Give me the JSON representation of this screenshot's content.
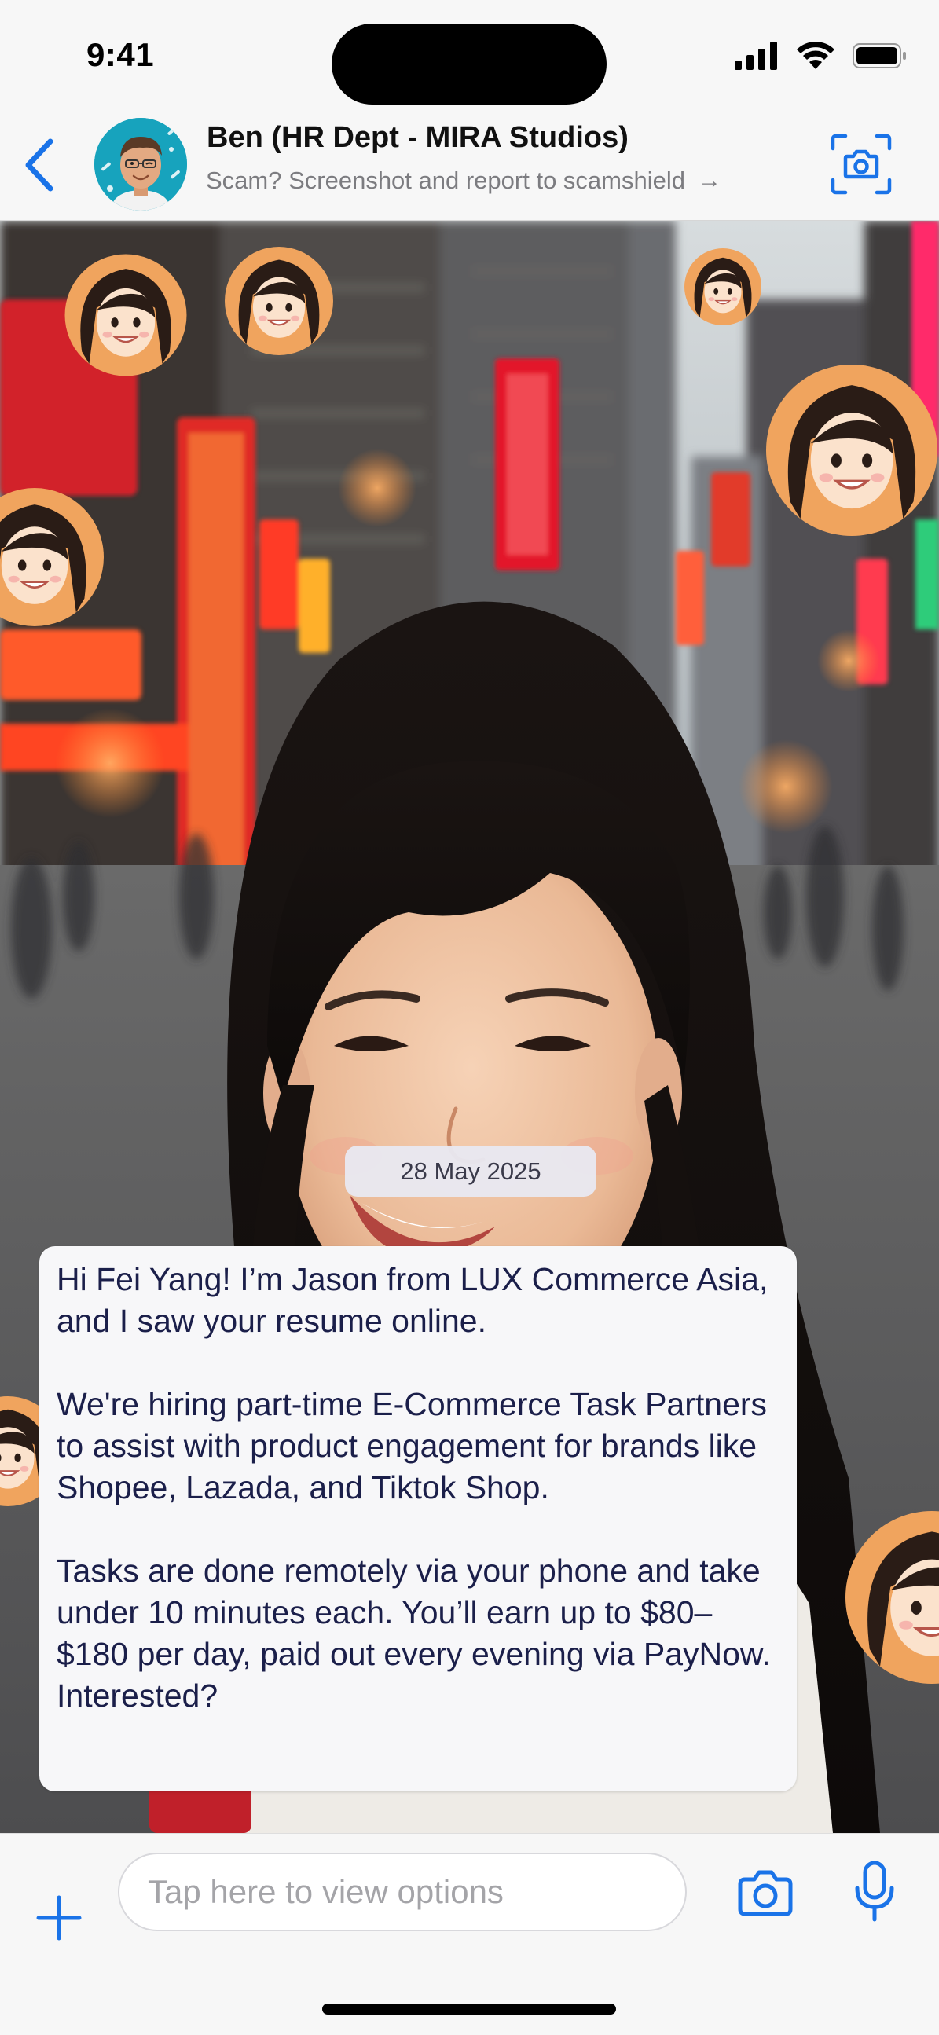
{
  "status_bar": {
    "time": "9:41",
    "icons": [
      "cellular-signal-icon",
      "wifi-icon",
      "battery-icon"
    ]
  },
  "chat_header": {
    "back_icon": "chevron-left-icon",
    "avatar_icon": "memoji-avatar-icon",
    "contact_name": "Ben (HR Dept - MIRA Studios)",
    "scam_notice": "Scam? Screenshot and report to scamshield",
    "scam_arrow": "→",
    "scan_icon": "scan-camera-icon"
  },
  "conversation": {
    "date_label": "28 May 2025",
    "message": {
      "paragraphs": [
        "Hi Fei Yang! I’m Jason from LUX Commerce Asia, and I saw your resume online.",
        "We're hiring part-time E-Commerce Task Partners to assist with product engagement for brands like Shopee, Lazada, and Tiktok Shop.",
        "Tasks are done remotely via your phone and take under 10 minutes each. You’ll earn up to $80–$180 per day, paid out every evening via PayNow. Interested?"
      ]
    }
  },
  "input_bar": {
    "placeholder": "Tap here to view options",
    "value": "",
    "plus_icon": "plus-icon",
    "camera_icon": "camera-icon",
    "mic_icon": "microphone-icon"
  },
  "colors": {
    "accent": "#1a73e8",
    "bubble_text": "#1b1f4a",
    "header_bg": "#f7f7f7"
  }
}
